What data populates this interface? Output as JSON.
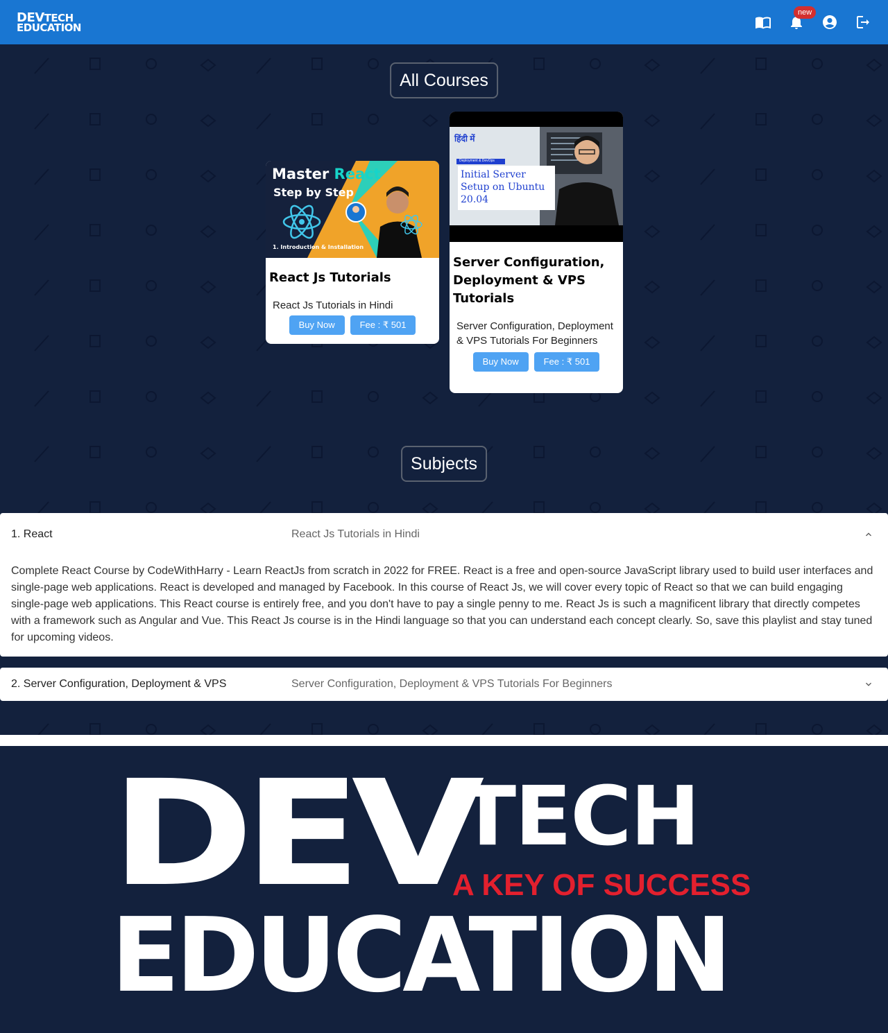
{
  "navbar": {
    "brand_line1_dev": "DEV",
    "brand_line1_tech": "TECH",
    "brand_line2": "EDUCATION",
    "icons": [
      "book-open-icon",
      "bell-icon",
      "account-circle-icon",
      "logout-icon"
    ],
    "notification_badge": "new"
  },
  "colors": {
    "navbar": "#1976d2",
    "background": "#13213d",
    "button": "#4fa3f3",
    "badge": "#d32f2f",
    "slogan": "#e3202e"
  },
  "sections": {
    "courses_title": "All Courses",
    "subjects_title": "Subjects"
  },
  "courses": [
    {
      "thumb_title_a": "Master ",
      "thumb_title_b": "React",
      "thumb_subtitle": "Step by Step",
      "thumb_caption": "1. Introduction & Installation",
      "title": "React Js Tutorials",
      "description": "React Js Tutorials in Hindi",
      "buy_label": "Buy Now",
      "fee_label": "Fee : ₹ 501"
    },
    {
      "thumb_hindi": "हिंदी में",
      "thumb_tag": "Deployment & DevOps",
      "thumb_title": "Initial Server Setup on Ubuntu 20.04",
      "title": "Server Configuration, Deployment & VPS Tutorials",
      "description": "Server Configuration, Deployment & VPS Tutorials For Beginners",
      "buy_label": "Buy Now",
      "fee_label": "Fee : ₹ 501"
    }
  ],
  "subjects": [
    {
      "number_title": "1. React",
      "subtitle": "React Js Tutorials in Hindi",
      "expanded": true,
      "body": "Complete React Course by CodeWithHarry - Learn ReactJs from scratch in 2022 for FREE. React is a free and open-source JavaScript library used to build user interfaces and single-page web applications. React is developed and managed by Facebook. In this course of React Js, we will cover every topic of React so that we can build engaging single-page web applications. This React course is entirely free, and you don't have to pay a single penny to me. React Js is such a magnificent library that directly competes with a framework such as Angular and Vue. This React Js course is in the Hindi language so that you can understand each concept clearly. So, save this playlist and stay tuned for upcoming videos."
    },
    {
      "number_title": "2. Server Configuration, Deployment & VPS",
      "subtitle": "Server Configuration, Deployment & VPS Tutorials For Beginners",
      "expanded": false
    }
  ],
  "hero": {
    "dev": "DEV",
    "tech": "TECH",
    "slogan": "A KEY OF SUCCESS",
    "education": "EDUCATION"
  }
}
